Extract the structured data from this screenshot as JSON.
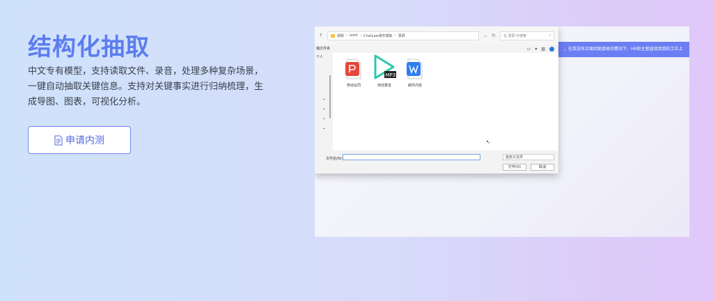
{
  "hero": {
    "title": "结构化抽取",
    "description": "中文专有模型，支持读取文件、录音，处理多种复杂场景，一键自动抽取关键信息。支持对关键事实进行归纳梳理，生成导图、图表，可视化分析。",
    "apply_button": "申请内测"
  },
  "demo": {
    "background_banner": "。在我没有正面回复接收的情况下，HR和主管直接到我的工位上",
    "dialog": {
      "breadcrumb": [
        "视频",
        "work",
        "ChatLaw课件模板",
        "录屏"
      ],
      "search_placeholder": "在 录屏 中搜索",
      "sidebar": [
        "缩文件夹",
        "个人"
      ],
      "files": [
        {
          "name": "劳动合同",
          "icon": "pdf-icon",
          "color": "#e5473a"
        },
        {
          "name": "劳动录音",
          "icon": "mp3-icon",
          "color": "#2cc7a8",
          "badge": "MP3"
        },
        {
          "name": "邮件内容",
          "icon": "wps-word-icon",
          "color": "#2f7ef0"
        }
      ],
      "filename_label": "文件名(N):",
      "filename_value": "",
      "filetype_value": "自定义文件",
      "open_button": "打开(O)",
      "cancel_button": "取消"
    }
  }
}
